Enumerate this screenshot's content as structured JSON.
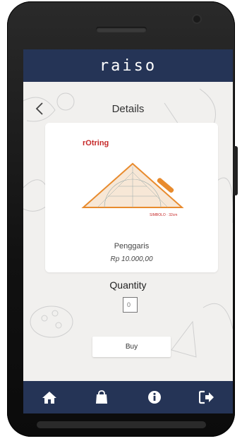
{
  "app": {
    "brand": "raiso"
  },
  "header": {
    "title": "Details",
    "back_icon": "chevron-left-icon"
  },
  "product": {
    "brand_logo": "rOtring",
    "name": "Penggaris",
    "price": "Rp 10.000,00",
    "image_icon": "triangle-ruler-image"
  },
  "quantity": {
    "label": "Quantity",
    "value": "0"
  },
  "actions": {
    "buy_label": "Buy"
  },
  "bottom_nav": {
    "items": [
      {
        "icon": "home-icon"
      },
      {
        "icon": "shopping-bag-icon"
      },
      {
        "icon": "info-icon"
      },
      {
        "icon": "logout-icon"
      }
    ]
  },
  "colors": {
    "primary": "#253456",
    "background": "#f1f0ee",
    "card": "#ffffff",
    "icon": "#ffffff",
    "brand_red": "#c62828",
    "ruler_orange": "#e88b2e"
  }
}
